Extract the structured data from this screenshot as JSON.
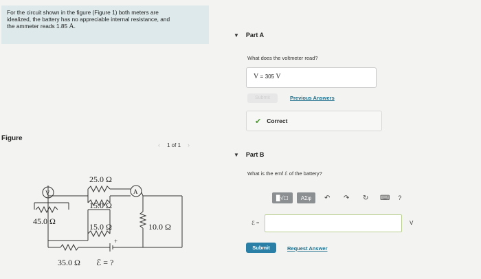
{
  "problem": {
    "line1": "For the circuit shown in the figure (Figure 1) both meters are",
    "line2": "idealized, the battery has no appreciable internal resistance, and",
    "line3_prefix": "the ammeter reads 1.85",
    "line3_unit": "A",
    "line3_suffix": "."
  },
  "figure": {
    "label": "Figure",
    "pager": "1 of 1",
    "prev_arrow": "‹",
    "next_arrow": "›",
    "circuit_labels": {
      "r25": "25.0 Ω",
      "r15a": "15.0 Ω",
      "r45": "45.0 Ω",
      "r15b": "15.0 Ω",
      "r10": "10.0 Ω",
      "r35": "35.0 Ω",
      "emf": "ℰ = ?",
      "voltmeter": "V",
      "ammeter": "A",
      "plus": "+"
    }
  },
  "partA": {
    "header": "Part A",
    "question": "What does the voltmeter read?",
    "answer_var": "V",
    "answer_eq": "=",
    "answer_value": "305",
    "answer_unit": "V",
    "submit_disabled": "Submit",
    "previous_answers": "Previous Answers",
    "status": "Correct"
  },
  "partB": {
    "header": "Part B",
    "question": "What is the emf ℰ of the battery?",
    "toolbar": {
      "template_btn": "▉√☐",
      "greek_btn": "ΑΣφ",
      "undo_icon": "↶",
      "redo_icon": "↷",
      "reset_icon": "↻",
      "keyboard_icon": "⌨",
      "help": "?"
    },
    "input_label": "ℰ =",
    "unit": "V",
    "submit": "Submit",
    "request_answer": "Request Answer"
  }
}
